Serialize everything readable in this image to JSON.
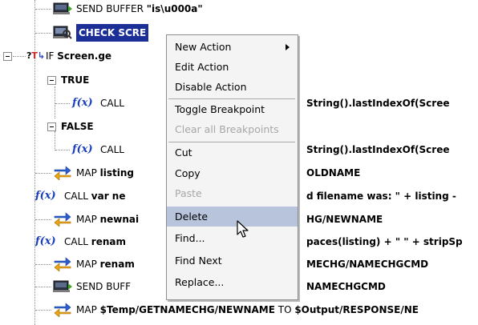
{
  "tree": {
    "rows": [
      {
        "keyword": "SEND BUFFER ",
        "bold": "\"is\\u000a\""
      },
      {
        "keyword": "",
        "bold": "CHECK SCRE"
      },
      {
        "keyword": "IF ",
        "bold": "Screen.ge"
      },
      {
        "keyword": "",
        "bold": "TRUE"
      },
      {
        "keyword": "CALL",
        "bold": ""
      },
      {
        "keyword": "",
        "bold": "FALSE"
      },
      {
        "keyword": "CALL",
        "bold": ""
      },
      {
        "keyword": "MAP ",
        "bold": "listing"
      },
      {
        "keyword": "CALL ",
        "bold": "var ne"
      },
      {
        "keyword": "MAP ",
        "bold": "newnai"
      },
      {
        "keyword": "CALL ",
        "bold": "renam"
      },
      {
        "keyword": "MAP ",
        "bold": "renam"
      },
      {
        "keyword": "SEND BUFF",
        "bold": ""
      },
      {
        "keyword": "MAP ",
        "bold": "$Temp/GETNAMECHG/NEWNAME",
        "tail_kw": " TO ",
        "tail_bold": "$Output/RESPONSE/NE"
      }
    ],
    "right_fragments": [
      "String().lastIndexOf(Scree",
      "String().lastIndexOf(Scree",
      "OLDNAME",
      "d filename was:  \" + listing -",
      "HG/NEWNAME",
      "paces(listing) + \" \" + stripSp",
      "MECHG/NAMECHGCMD",
      "NAMECHGCMD"
    ]
  },
  "menu": {
    "items": [
      {
        "label": "New Action",
        "submenu": true,
        "disabled": false
      },
      {
        "label": "Edit Action",
        "disabled": false
      },
      {
        "label": "Disable Action",
        "disabled": false
      },
      {
        "label": "Toggle Breakpoint",
        "disabled": false
      },
      {
        "label": "Clear all Breakpoints",
        "disabled": true
      },
      {
        "label": "Cut",
        "disabled": false
      },
      {
        "label": "Copy",
        "disabled": false
      },
      {
        "label": "Paste",
        "disabled": true
      },
      {
        "label": "Delete",
        "disabled": false,
        "hover": true
      },
      {
        "label": "Find...",
        "disabled": false
      },
      {
        "label": "Find Next",
        "disabled": false
      },
      {
        "label": "Replace...",
        "disabled": false
      }
    ]
  },
  "colors": {
    "selection": "#1c2f97",
    "menu_hover": "#b8c4dc",
    "fx_blue": "#1a3fbf"
  }
}
